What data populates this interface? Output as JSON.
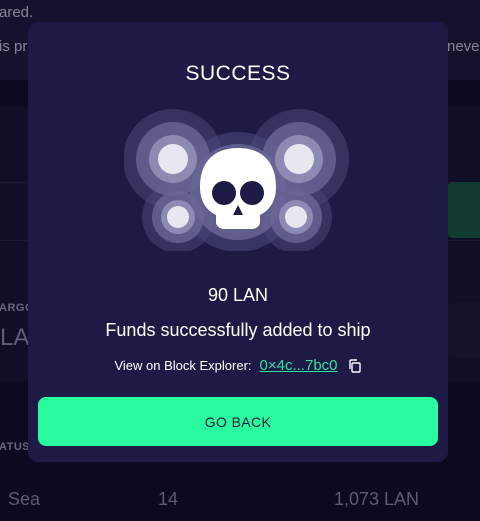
{
  "background": {
    "top_line_1": "ared.",
    "top_line_2_left": "is pr",
    "top_line_2_right": "neve",
    "cargo_label": "ARGO",
    "cargo_value": "LA",
    "status_label": "ATUS",
    "row": {
      "location": "Sea",
      "count": "14",
      "amount": "1,073 LAN"
    }
  },
  "modal": {
    "title": "SUCCESS",
    "amount": "90 LAN",
    "message": "Funds successfully added to ship",
    "explorer_label": "View on Block Explorer:",
    "explorer_link": "0×4c...7bc0",
    "go_back_label": "GO BACK",
    "icon": "skull-icon",
    "accent_color": "#29fc9f"
  }
}
